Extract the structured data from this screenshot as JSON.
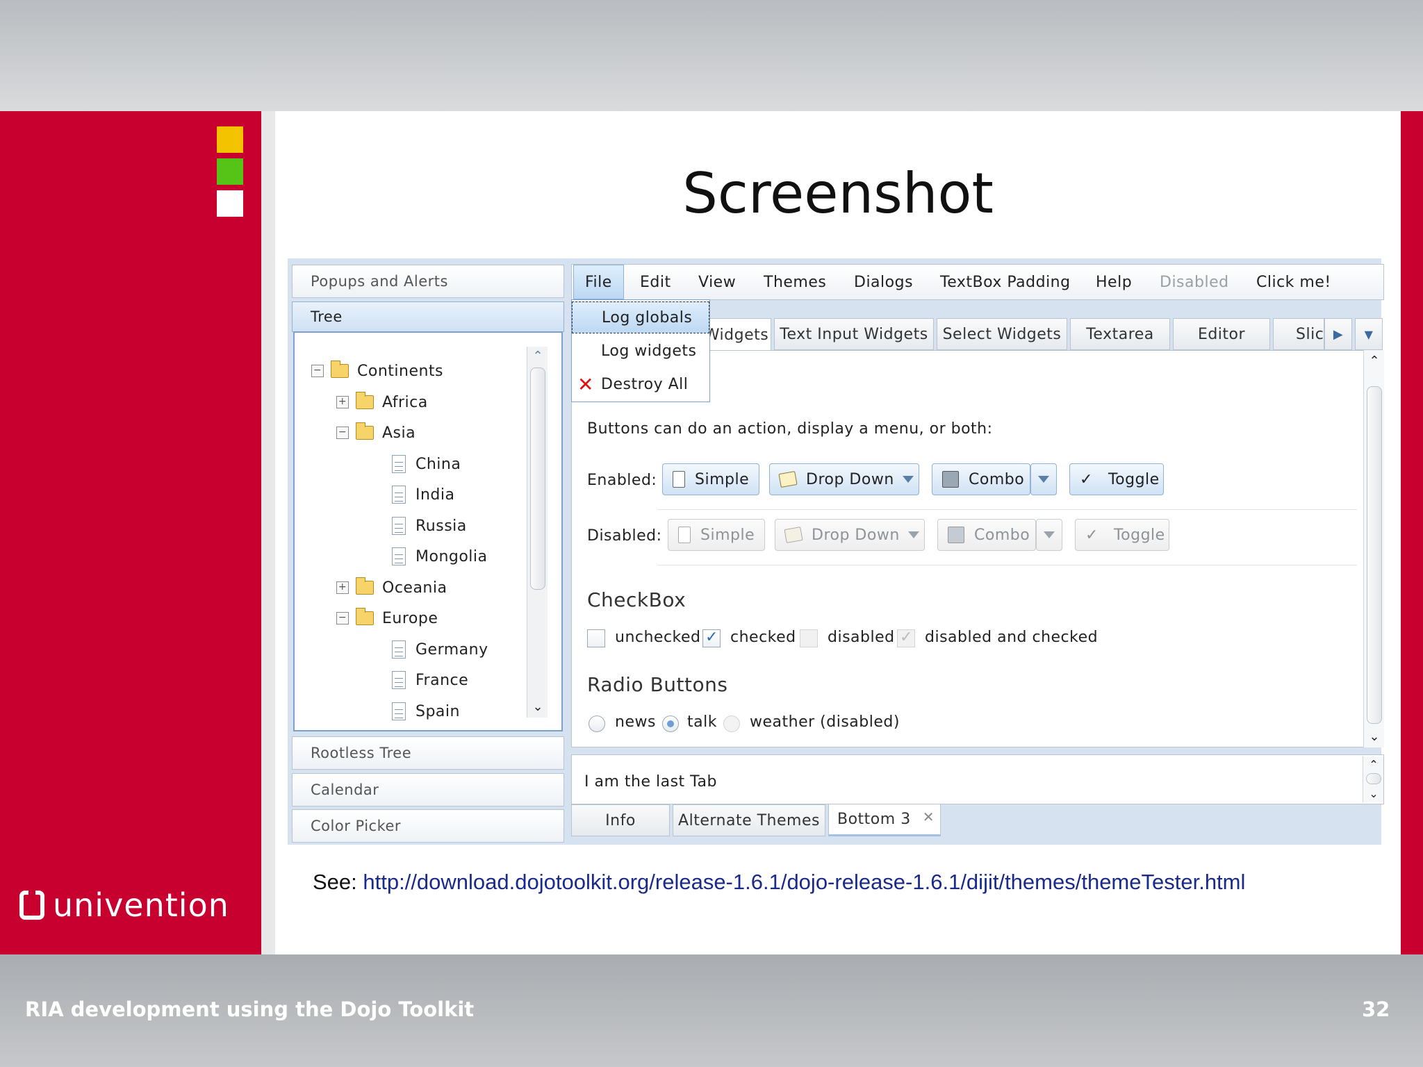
{
  "slide": {
    "title": "Screenshot",
    "footer_left": "RIA development using the Dojo Toolkit",
    "page_number": "32",
    "logo_text": "univention",
    "see_prefix": "See: ",
    "see_link": "http://download.dojotoolkit.org/release-1.6.1/dojo-release-1.6.1/dijit/themes/themeTester.html",
    "colors": {
      "brand_red": "#c8002f",
      "square_yellow": "#f4c300",
      "square_green": "#56c317",
      "square_white": "#ffffff"
    }
  },
  "accordion": {
    "panes": [
      "Popups and Alerts",
      "Tree",
      "Rootless Tree",
      "Calendar",
      "Color Picker"
    ]
  },
  "tree": {
    "items": [
      {
        "label": "Continents",
        "type": "folder",
        "expanded": true
      },
      {
        "label": "Africa",
        "type": "folder",
        "expanded": false
      },
      {
        "label": "Asia",
        "type": "folder",
        "expanded": true
      },
      {
        "label": "China",
        "type": "doc"
      },
      {
        "label": "India",
        "type": "doc"
      },
      {
        "label": "Russia",
        "type": "doc"
      },
      {
        "label": "Mongolia",
        "type": "doc"
      },
      {
        "label": "Oceania",
        "type": "folder",
        "expanded": false
      },
      {
        "label": "Europe",
        "type": "folder",
        "expanded": true
      },
      {
        "label": "Germany",
        "type": "doc"
      },
      {
        "label": "France",
        "type": "doc"
      },
      {
        "label": "Spain",
        "type": "doc"
      }
    ]
  },
  "menubar": {
    "items": [
      "File",
      "Edit",
      "View",
      "Themes",
      "Dialogs",
      "TextBox Padding",
      "Help",
      "Disabled",
      "Click me!"
    ]
  },
  "file_menu": {
    "items": [
      "Log globals",
      "Log widgets",
      "Destroy All"
    ]
  },
  "tabs": [
    "Widgets",
    "Text Input Widgets",
    "Select Widgets",
    "Textarea",
    "Editor",
    "Slic"
  ],
  "buttons_section": {
    "intro": "Buttons can do an action, display a menu, or both:",
    "enabled_label": "Enabled:",
    "disabled_label": "Disabled:",
    "simple": "Simple",
    "drop_down": "Drop Down",
    "combo": "Combo",
    "toggle": "Toggle"
  },
  "checkbox_section": {
    "heading": "CheckBox",
    "unchecked": "unchecked",
    "checked": "checked",
    "disabled": "disabled",
    "disabled_checked": "disabled and checked"
  },
  "radio_section": {
    "heading": "Radio Buttons",
    "news": "news",
    "talk": "talk",
    "weather": "weather (disabled)"
  },
  "bottom_pane": {
    "text": "I am the last Tab",
    "tabs": [
      "Info",
      "Alternate Themes",
      "Bottom 3"
    ]
  }
}
